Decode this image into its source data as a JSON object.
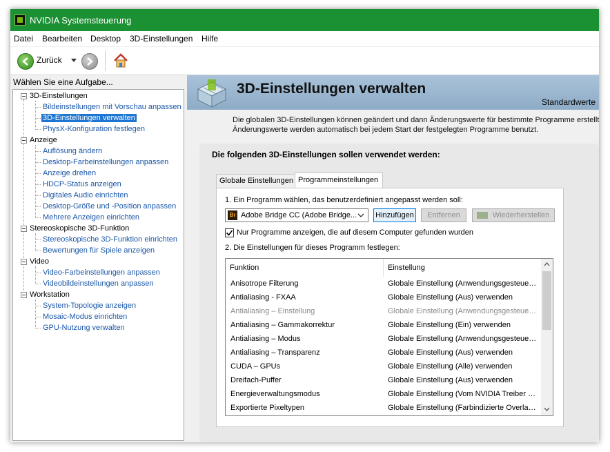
{
  "window": {
    "title": "NVIDIA Systemsteuerung"
  },
  "menu": [
    "Datei",
    "Bearbeiten",
    "Desktop",
    "3D-Einstellungen",
    "Hilfe"
  ],
  "toolbar": {
    "back_label": "Zurück"
  },
  "left_pane": {
    "header": "Wählen Sie eine Aufgabe...",
    "categories": [
      {
        "label": "3D-Einstellungen",
        "items": [
          "Bildeinstellungen mit Vorschau anpassen",
          "3D-Einstellungen verwalten",
          "PhysX-Konfiguration festlegen"
        ]
      },
      {
        "label": "Anzeige",
        "items": [
          "Auflösung ändern",
          "Desktop-Farbeinstellungen anpassen",
          "Anzeige drehen",
          "HDCP-Status anzeigen",
          "Digitales Audio einrichten",
          "Desktop-Größe und -Position anpassen",
          "Mehrere Anzeigen einrichten"
        ]
      },
      {
        "label": "Stereoskopische 3D-Funktion",
        "items": [
          "Stereoskopische 3D-Funktion einrichten",
          "Bewertungen für Spiele anzeigen"
        ]
      },
      {
        "label": "Video",
        "items": [
          "Video-Farbeinstellungen anpassen",
          "Videobildeinstellungen anpassen"
        ]
      },
      {
        "label": "Workstation",
        "items": [
          "System-Topologie anzeigen",
          "Mosaic-Modus einrichten",
          "GPU-Nutzung verwalten"
        ]
      }
    ],
    "selected": "3D-Einstellungen verwalten"
  },
  "main": {
    "title": "3D-Einstellungen verwalten",
    "restore_defaults": "Standardwerte",
    "description_line1": "Die globalen 3D-Einstellungen können geändert und dann Änderungswerte für bestimmte Programme erstellt werd",
    "description_line2": "Änderungswerte werden automatisch bei jedem Start der festgelegten Programme benutzt.",
    "group_title": "Die folgenden 3D-Einstellungen sollen verwendet werden:",
    "tabs": [
      "Globale Einstellungen",
      "Programmeinstellungen"
    ],
    "active_tab": "Programmeinstellungen",
    "step1_label": "1. Ein Programm wählen, das benutzerdefiniert angepasst werden soll:",
    "program_select": {
      "badge": "Br",
      "value": "Adobe Bridge CC (Adobe Bridge..."
    },
    "buttons": {
      "add": "Hinzufügen",
      "remove": "Entfernen",
      "restore": "Wiederherstellen"
    },
    "checkbox": {
      "label": "Nur Programme anzeigen, die auf diesem Computer gefunden wurden",
      "checked": true
    },
    "step2_label": "2. Die Einstellungen für dieses Programm festlegen:",
    "table": {
      "columns": [
        "Funktion",
        "Einstellung"
      ],
      "rows": [
        {
          "feature": "Anisotrope Filterung",
          "setting": "Globale Einstellung (Anwendungsgesteuer...",
          "dimmed": false
        },
        {
          "feature": "Antialiasing - FXAA",
          "setting": "Globale Einstellung (Aus) verwenden",
          "dimmed": false
        },
        {
          "feature": "Antialiasing – Einstellung",
          "setting": "Globale Einstellung (Anwendungsgesteuer...",
          "dimmed": true
        },
        {
          "feature": "Antialiasing – Gammakorrektur",
          "setting": "Globale Einstellung (Ein) verwenden",
          "dimmed": false
        },
        {
          "feature": "Antialiasing – Modus",
          "setting": "Globale Einstellung (Anwendungsgesteuer...",
          "dimmed": false
        },
        {
          "feature": "Antialiasing – Transparenz",
          "setting": "Globale Einstellung (Aus) verwenden",
          "dimmed": false
        },
        {
          "feature": "CUDA – GPUs",
          "setting": "Globale Einstellung (Alle) verwenden",
          "dimmed": false
        },
        {
          "feature": "Dreifach-Puffer",
          "setting": "Globale Einstellung (Aus) verwenden",
          "dimmed": false
        },
        {
          "feature": "Energieverwaltungsmodus",
          "setting": "Globale Einstellung (Vom NVIDIA Treiber g...",
          "dimmed": false
        },
        {
          "feature": "Exportierte Pixeltypen",
          "setting": "Globale Einstellung (Farbindizierte Overlay...",
          "dimmed": false
        }
      ]
    }
  },
  "colors": {
    "titlebar": "#1c9133",
    "link": "#1a57a8",
    "selection": "#1e75d2",
    "banner": "#a9c2d9"
  }
}
